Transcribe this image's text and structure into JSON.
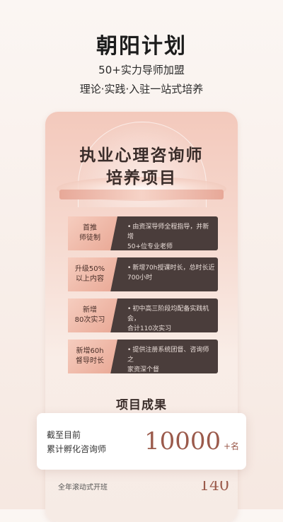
{
  "hero": {
    "title": "朝阳计划",
    "subtitle1": "50+实力导师加盟",
    "subtitle2": "理论·实践·入驻一站式培养"
  },
  "card": {
    "title_line1": "执业心理咨询师",
    "title_line2": "培养项目",
    "rows": [
      {
        "tag_line1": "首推",
        "tag_line2": "师徒制",
        "text_line1": "由资深导师全程指导，并新增",
        "text_line2": "50+位专业老师"
      },
      {
        "tag_line1": "升级50%",
        "tag_line2": "以上内容",
        "text_line1": "新增70h授课时长，总时长近",
        "text_line2": "700小时"
      },
      {
        "tag_line1": "新增",
        "tag_line2": "80次实习",
        "text_line1": "初中高三阶段均配备实践机会，",
        "text_line2": "合计110次实习"
      },
      {
        "tag_line1": "新增60h",
        "tag_line2": "督导时长",
        "text_line1": "提供注册系统团督、咨询师之",
        "text_line2": "家资深个督"
      }
    ]
  },
  "results": {
    "title": "项目成果",
    "label_line1": "截至目前",
    "label_line2": "累计孵化咨询师",
    "number": "10000",
    "unit": "+名",
    "peek_label": "全年滚动式开班",
    "peek_number": "140"
  },
  "colors": {
    "accent": "#9b5a4b",
    "row_bg": "#4a3d3b",
    "tag_bg": "#f0b8a6"
  }
}
